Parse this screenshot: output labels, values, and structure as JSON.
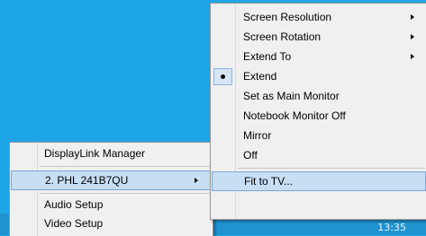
{
  "taskbar": {
    "clock": "13:35"
  },
  "left_menu": {
    "items": [
      {
        "label": "DisplayLink Manager"
      },
      {
        "label": "2. PHL 241B7QU",
        "has_submenu": true,
        "highlighted": true
      },
      {
        "label": "Audio Setup"
      },
      {
        "label": "Video Setup"
      }
    ]
  },
  "right_menu": {
    "items": [
      {
        "label": "Screen Resolution",
        "has_submenu": true
      },
      {
        "label": "Screen Rotation",
        "has_submenu": true
      },
      {
        "label": "Extend To",
        "has_submenu": true
      },
      {
        "label": "Extend",
        "checked": true
      },
      {
        "label": "Set as Main Monitor"
      },
      {
        "label": "Notebook Monitor Off"
      },
      {
        "label": "Mirror"
      },
      {
        "label": "Off"
      },
      {
        "label": "Fit to TV...",
        "highlighted": true
      }
    ]
  },
  "colors": {
    "desktop": "#1ea6e8",
    "menu_background": "#f0f0f0",
    "highlight": "#c7def3"
  }
}
